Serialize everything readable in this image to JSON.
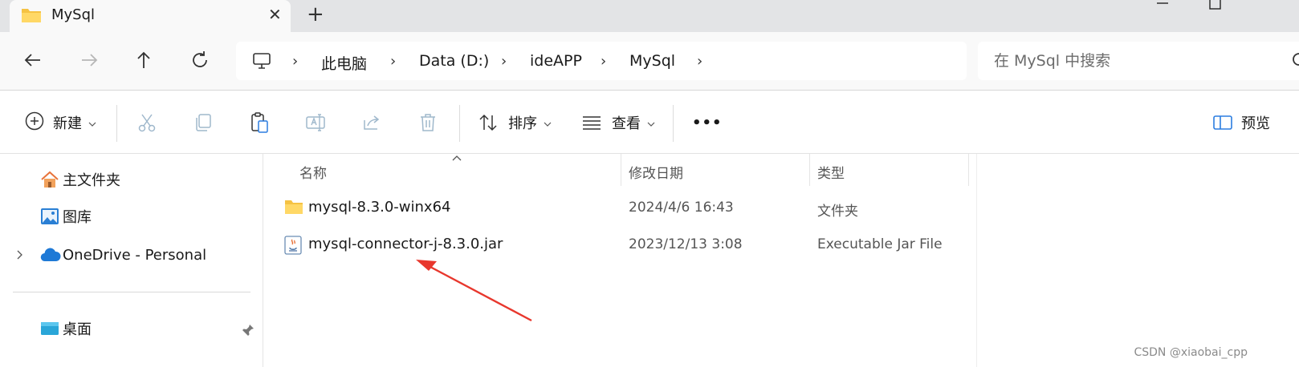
{
  "tab": {
    "title": "MySql",
    "close_label": "✕",
    "new_tab_label": "+"
  },
  "address": {
    "crumbs": [
      "此电脑",
      "Data (D:)",
      "ideAPP",
      "MySql"
    ],
    "separator": "›"
  },
  "search": {
    "placeholder": "在 MySql 中搜索"
  },
  "toolbar": {
    "new_label": "新建",
    "sort_label": "排序",
    "view_label": "查看",
    "more_label": "•••",
    "preview_label": "预览"
  },
  "nav": {
    "items": [
      {
        "label": "主文件夹"
      },
      {
        "label": "图库"
      },
      {
        "label": "OneDrive - Personal"
      },
      {
        "label": "桌面"
      }
    ]
  },
  "list": {
    "columns": {
      "name": "名称",
      "modified": "修改日期",
      "type": "类型"
    },
    "rows": [
      {
        "name": "mysql-8.3.0-winx64",
        "modified": "2024/4/6 16:43",
        "type": "文件夹",
        "icon": "folder-icon"
      },
      {
        "name": "mysql-connector-j-8.3.0.jar",
        "modified": "2023/12/13 3:08",
        "type": "Executable Jar File",
        "icon": "jar-file-icon"
      }
    ]
  },
  "watermark": "CSDN @xiaobai_cpp",
  "colors": {
    "annotation_arrow": "#e8372d",
    "folder": "#f5c243",
    "onedrive": "#1e79d6"
  }
}
